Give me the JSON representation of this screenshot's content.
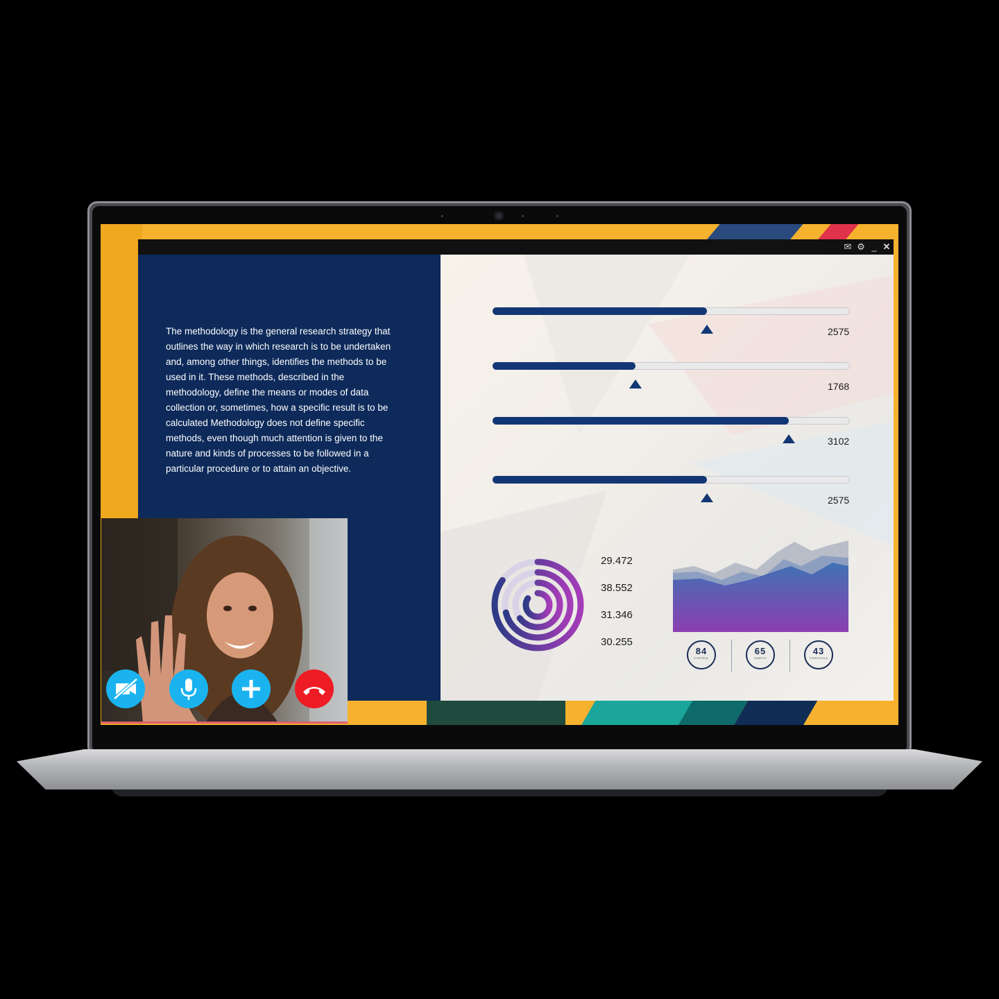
{
  "app": {
    "window_controls": [
      "mail-icon",
      "gear-icon",
      "minimize-icon",
      "close-icon"
    ],
    "methodology_text": "The methodology is the general research strategy that outlines the way in which research is to be undertaken and, among other things, identifies the methods to be used in it. These methods, described in the methodology, define the means or modes of data collection or, sometimes, how a specific result is to be calculated Methodology does not define specific methods, even though much attention is given to the nature and kinds of processes to be followed in a particular procedure or to attain an objective."
  },
  "dashboard": {
    "bars": [
      {
        "value": "2575",
        "fill": 0.6
      },
      {
        "value": "1768",
        "fill": 0.4
      },
      {
        "value": "3102",
        "fill": 0.83
      },
      {
        "value": "2575",
        "fill": 0.6
      }
    ],
    "ring_values": [
      "29.472",
      "38.552",
      "31.346",
      "30.255"
    ],
    "stats": [
      {
        "value": "84",
        "label": "CONTROL"
      },
      {
        "value": "65",
        "label": "SAMPLE"
      },
      {
        "value": "43",
        "label": "THRESHOLD"
      }
    ]
  },
  "video_call": {
    "buttons": [
      {
        "name": "camera-off-button",
        "icon": "video-off-icon",
        "color": "#1ab3ef"
      },
      {
        "name": "microphone-button",
        "icon": "microphone-icon",
        "color": "#1ab3ef"
      },
      {
        "name": "add-participant-button",
        "icon": "plus-icon",
        "color": "#1ab3ef"
      },
      {
        "name": "end-call-button",
        "icon": "phone-hangup-icon",
        "color": "#ee1c25"
      }
    ]
  },
  "colors": {
    "navy": "#0d2a5a",
    "bar_fill": "#123774",
    "screen_orange": "#f6b22e",
    "call_blue": "#1ab3ef",
    "call_red": "#ee1c25"
  }
}
